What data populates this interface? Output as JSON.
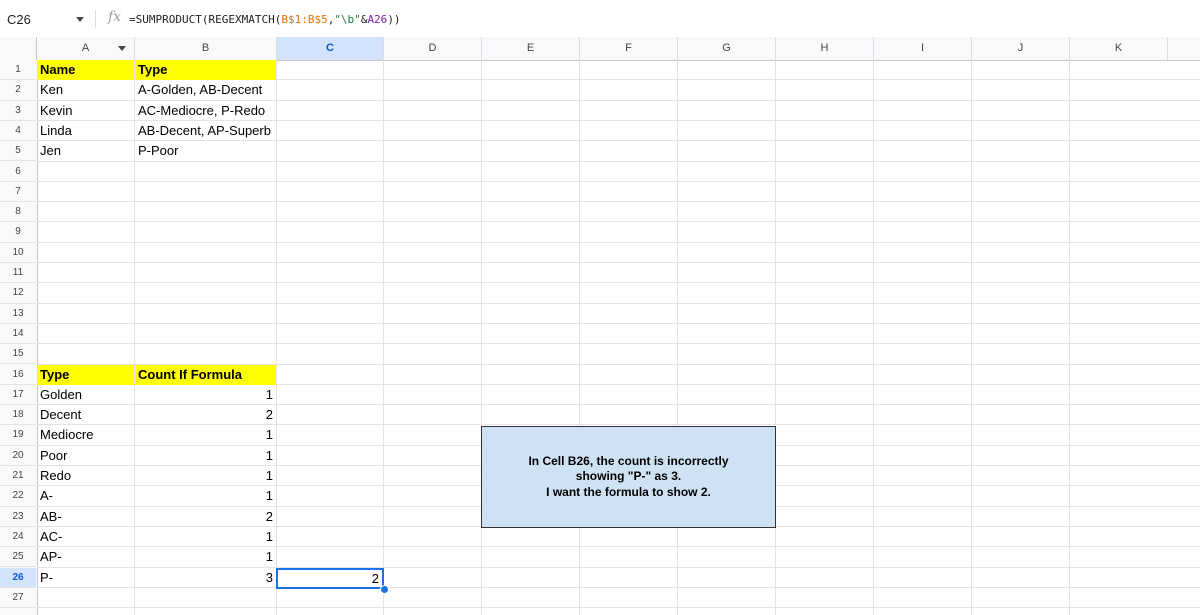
{
  "formula_bar": {
    "cell_ref": "C26",
    "fx_label": "fx",
    "formula_parts": {
      "prefix": "=SUMPRODUCT(REGEXMATCH(",
      "range": "B$1:B$5",
      "comma": ",",
      "pattern": "\"\\b\"",
      "amp": "&",
      "ref": "A26",
      "suffix": "))"
    }
  },
  "columns": [
    "A",
    "B",
    "C",
    "D",
    "E",
    "F",
    "G",
    "H",
    "I",
    "J",
    "K"
  ],
  "selected_column": "C",
  "rows": [
    "1",
    "2",
    "3",
    "4",
    "5",
    "6",
    "7",
    "8",
    "9",
    "10",
    "11",
    "12",
    "13",
    "14",
    "15",
    "16",
    "17",
    "18",
    "19",
    "20",
    "21",
    "22",
    "23",
    "24",
    "25",
    "26",
    "27"
  ],
  "selected_row": "26",
  "table1": {
    "header": {
      "name": "Name",
      "type": "Type"
    },
    "rows": [
      {
        "name": "Ken",
        "type": "A-Golden, AB-Decent"
      },
      {
        "name": "Kevin",
        "type": "AC-Mediocre, P-Redo"
      },
      {
        "name": "Linda",
        "type": "AB-Decent, AP-Superb"
      },
      {
        "name": "Jen",
        "type": "P-Poor"
      }
    ]
  },
  "table2": {
    "header": {
      "type": "Type",
      "count": "Count If Formula"
    },
    "rows": [
      {
        "type": "Golden",
        "count": "1"
      },
      {
        "type": "Decent",
        "count": "2"
      },
      {
        "type": "Mediocre",
        "count": "1"
      },
      {
        "type": "Poor",
        "count": "1"
      },
      {
        "type": "Redo",
        "count": "1"
      },
      {
        "type": "A-",
        "count": "1"
      },
      {
        "type": "AB-",
        "count": "2"
      },
      {
        "type": "AC-",
        "count": "1"
      },
      {
        "type": "AP-",
        "count": "1"
      },
      {
        "type": "P-",
        "count": "3"
      }
    ]
  },
  "selected_cell_value": "2",
  "note": {
    "line1": "In Cell B26, the count is incorrectly",
    "line2": "showing \"P-\" as 3.",
    "line3": "I want the formula to show 2."
  },
  "colors": {
    "header_fill": "#ffff00",
    "note_fill": "#cfe2f3",
    "selection": "#1a73e8"
  }
}
